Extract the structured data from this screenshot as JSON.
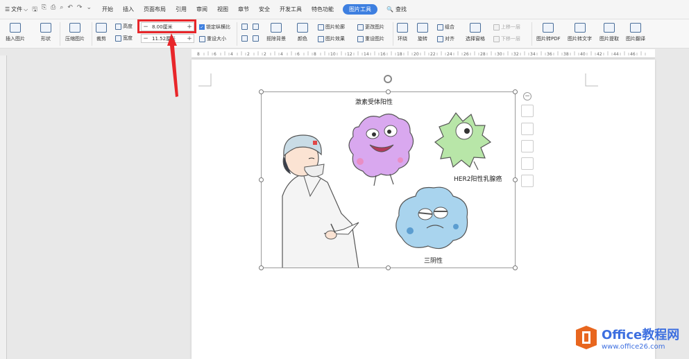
{
  "menu": {
    "file": "文件",
    "tabs": [
      "开始",
      "插入",
      "页面布局",
      "引用",
      "审阅",
      "视图",
      "章节",
      "安全",
      "开发工具",
      "特色功能"
    ],
    "active_tab": "图片工具",
    "search": "查找"
  },
  "ribbon": {
    "insert_picture": "插入图片",
    "shape": "形状",
    "compress": "压缩图片",
    "crop": "裁剪",
    "height_label": "高度",
    "height_value": "8.00厘米",
    "width_label": "宽度",
    "width_value": "11.52厘米",
    "lock_ratio": "锁定纵横比",
    "reset_size": "重设大小",
    "remove_bg": "抠除背景",
    "color": "颜色",
    "picture_outline": "图片轮廓",
    "picture_effect": "图片效果",
    "change_picture": "更改图片",
    "reset_picture": "重设图片",
    "wrap": "环绕",
    "rotate": "旋转",
    "group": "组合",
    "align": "对齐",
    "selection_pane": "选择窗格",
    "bring_forward": "上移一层",
    "send_backward": "下移一层",
    "to_pdf": "图片转PDF",
    "to_text": "图片转文字",
    "extract": "图片提取",
    "translate": "图片翻译"
  },
  "ruler_ticks": [
    "8",
    "6",
    "4",
    "2",
    "2",
    "4",
    "6",
    "8",
    "10",
    "12",
    "14",
    "16",
    "18",
    "20",
    "22",
    "24",
    "26",
    "28",
    "30",
    "32",
    "34",
    "36",
    "38",
    "40",
    "42",
    "44",
    "46"
  ],
  "image_labels": {
    "hormone": "激素受体阳性",
    "her2": "HER2阳性乳腺癌",
    "triple": "三阴性"
  },
  "watermark": {
    "brand": "Office教程网",
    "url": "www.office26.com"
  },
  "colors": {
    "accent": "#3d7fe0",
    "highlight": "#e8262a",
    "purple_cell": "#d9a8ef",
    "green_cell": "#b8e6a8",
    "blue_cell": "#a9d4ee",
    "watermark_orange": "#e8661e"
  }
}
